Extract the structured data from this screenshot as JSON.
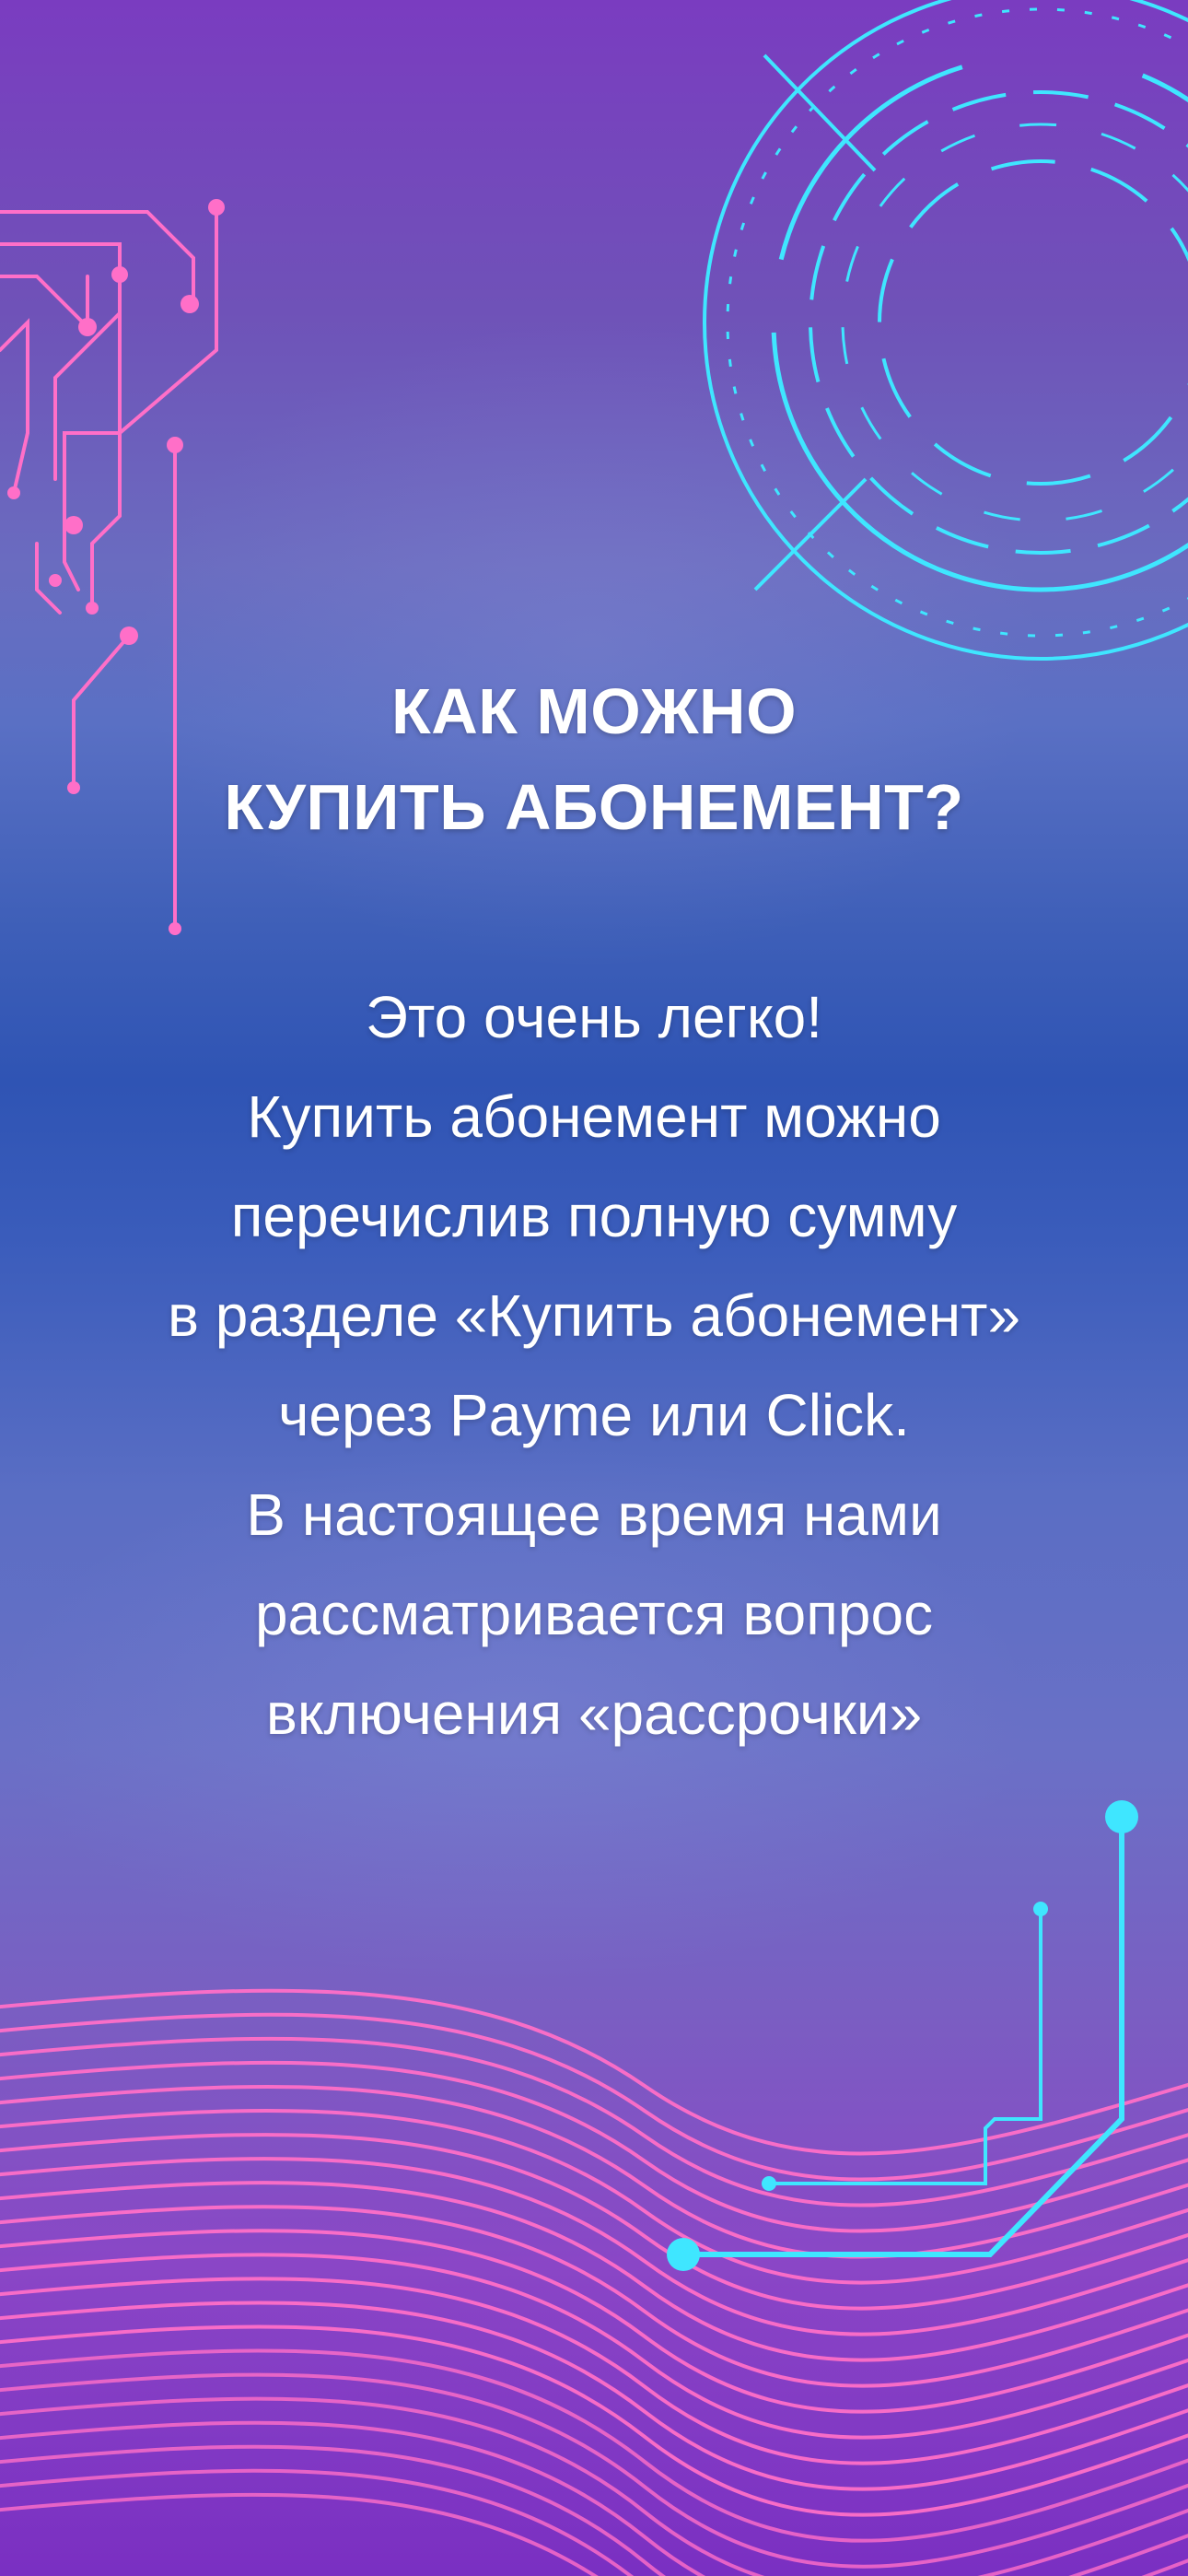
{
  "title": {
    "line1": "КАК МОЖНО",
    "line2": "КУПИТЬ АБОНЕМЕНТ?"
  },
  "body": {
    "lines": [
      "Это очень легко!",
      "Купить абонемент можно",
      "перечислив полную сумму",
      "в разделе «Купить абонемент»",
      "через Payme или Click.",
      "В настоящее время нами",
      "рассматривается вопрос",
      " включения «рассрочки»"
    ]
  },
  "colors": {
    "pink": "#ff6fc8",
    "cyan": "#3fe6ff",
    "text": "#ffffff"
  },
  "icons": {
    "top_left": "circuit-lines-icon",
    "top_right": "concentric-rings-icon",
    "bottom_right": "circuit-lines-icon",
    "bottom": "wave-lines-icon"
  }
}
